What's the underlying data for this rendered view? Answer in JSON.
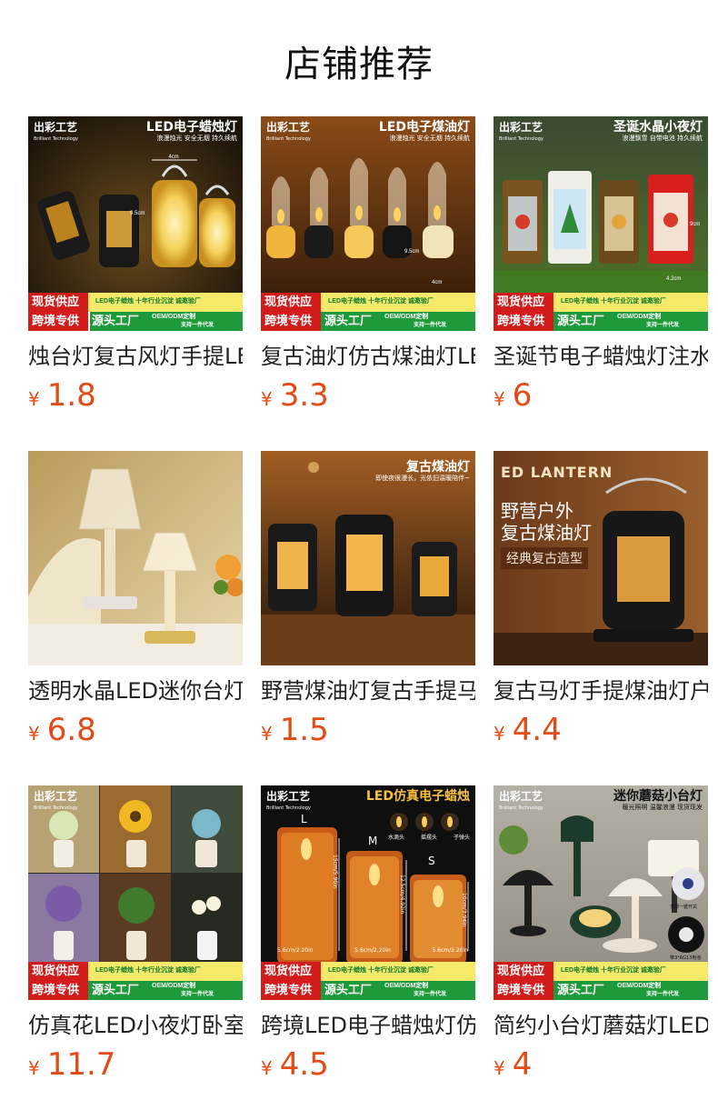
{
  "page": {
    "title": "店铺推荐"
  },
  "products": [
    {
      "name": "烛台灯复古风灯手提LED蜡烛灯",
      "currency": "¥",
      "price": "1.8",
      "image_brand": "出彩工艺",
      "image_brand_sub": "Brilliant Technology",
      "image_headline": "LED电子蜡烛灯",
      "image_sub": "浪漫烛光 安全无烟 持久续航",
      "promo": true
    },
    {
      "name": "复古油灯仿古煤油灯LED电子蜡烛",
      "currency": "¥",
      "price": "3.3",
      "image_brand": "出彩工艺",
      "image_brand_sub": "Brilliant Technology",
      "image_headline": "LED电子煤油灯",
      "image_sub": "浪漫烛光 安全无烟 持久续航",
      "promo": true
    },
    {
      "name": "圣诞节电子蜡烛灯注水水晶小夜灯",
      "currency": "¥",
      "price": "6",
      "image_brand": "出彩工艺",
      "image_brand_sub": "Brilliant Technology",
      "image_headline": "圣诞水晶小夜灯",
      "image_sub": "浪漫飘雪 自带电池 持久续航",
      "promo": true
    },
    {
      "name": "透明水晶LED迷你台灯小夜灯",
      "currency": "¥",
      "price": "6.8",
      "image_headline": "",
      "image_sub": "",
      "promo": false
    },
    {
      "name": "野营煤油灯复古手提马灯",
      "currency": "¥",
      "price": "1.5",
      "image_headline": "复古煤油灯",
      "image_sub": "即使夜很漫长，光依旧温暖陪伴~",
      "promo": false
    },
    {
      "name": "复古马灯手提煤油灯户外野营",
      "currency": "¥",
      "price": "4.4",
      "image_headline": "ED LANTERN",
      "image_sub": "野营户外",
      "image_sub2": "复古煤油灯",
      "image_tag": "经典复古造型",
      "promo": false
    },
    {
      "name": "仿真花LED小夜灯卧室摆件",
      "currency": "¥",
      "price": "11.7",
      "image_brand": "出彩工艺",
      "image_brand_sub": "Brilliant Technology",
      "image_headline": "",
      "image_sub": "",
      "promo": true
    },
    {
      "name": "跨境LED电子蜡烛灯仿真亚克力",
      "currency": "¥",
      "price": "4.5",
      "image_brand": "出彩工艺",
      "image_brand_sub": "Brilliant Technology",
      "image_headline": "LED仿真电子蜡烛",
      "image_sub": "",
      "sizes": [
        "L",
        "M",
        "S"
      ],
      "size_dims": [
        "5.6cm/2.20in",
        "5.6cm/2.20in",
        "5.6cm/2.20in"
      ],
      "size_heights": [
        "15cm/5.90in",
        "12.5cm/4.92in",
        "10cm/3.94in"
      ],
      "flame_types": [
        "水滴头",
        "摇摆头",
        "子弹头"
      ],
      "promo": true
    },
    {
      "name": "简约小台灯蘑菇灯LED充电台灯",
      "currency": "¥",
      "price": "4",
      "image_brand": "出彩工艺",
      "image_brand_sub": "Brilliant Technology",
      "image_headline": "迷你蘑菇小台灯",
      "image_sub": "暖光照明 温馨浪漫 现货现发",
      "image_note1": "顶部一键开关",
      "image_note2": "带3*AG13电池",
      "promo": true
    }
  ],
  "promo_banner": {
    "line1_left": "现货供应",
    "line1_right": "LED电子蜡烛 十年行业沉淀 诚邀验厂",
    "line2_left": "跨境专供",
    "line2_mid": "源头工厂",
    "line2_right_a": "OEM/ODM定制",
    "line2_right_b": "支持一件代发"
  },
  "colors": {
    "price": "#e44a14",
    "promo_red": "#d21c1c",
    "promo_green": "#1f9a3a",
    "promo_yellow": "#f5e96a"
  }
}
